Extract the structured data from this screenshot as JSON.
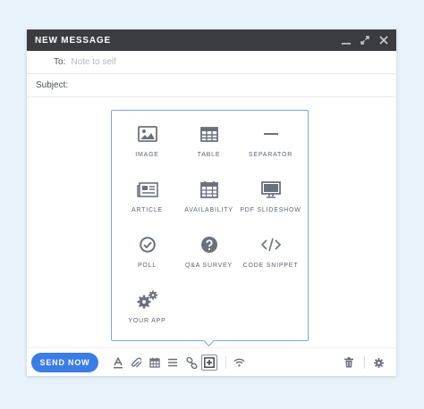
{
  "window": {
    "title": "NEW MESSAGE"
  },
  "compose": {
    "to_label": "To:",
    "to_placeholder": "Note to self",
    "to_value": "",
    "subject_label": "Subject:",
    "subject_value": ""
  },
  "insert_panel": {
    "items": [
      {
        "label": "IMAGE",
        "icon": "image-icon"
      },
      {
        "label": "TABLE",
        "icon": "table-icon"
      },
      {
        "label": "SEPARATOR",
        "icon": "separator-icon"
      },
      {
        "label": "ARTICLE",
        "icon": "article-icon"
      },
      {
        "label": "AVAILABILITY",
        "icon": "calendar-icon"
      },
      {
        "label": "PDF SLIDESHOW",
        "icon": "monitor-icon"
      },
      {
        "label": "POLL",
        "icon": "check-circle-icon"
      },
      {
        "label": "Q&A SURVEY",
        "icon": "question-circle-icon"
      },
      {
        "label": "CODE SNIPPET",
        "icon": "code-icon"
      },
      {
        "label": "YOUR APP",
        "icon": "gears-icon"
      }
    ]
  },
  "toolbar": {
    "send_label": "SEND NOW"
  },
  "colors": {
    "titlebar": "#3a3c40",
    "accent": "#3a7de6",
    "icon": "#6b717c",
    "panel_border": "#7ea4e4"
  }
}
